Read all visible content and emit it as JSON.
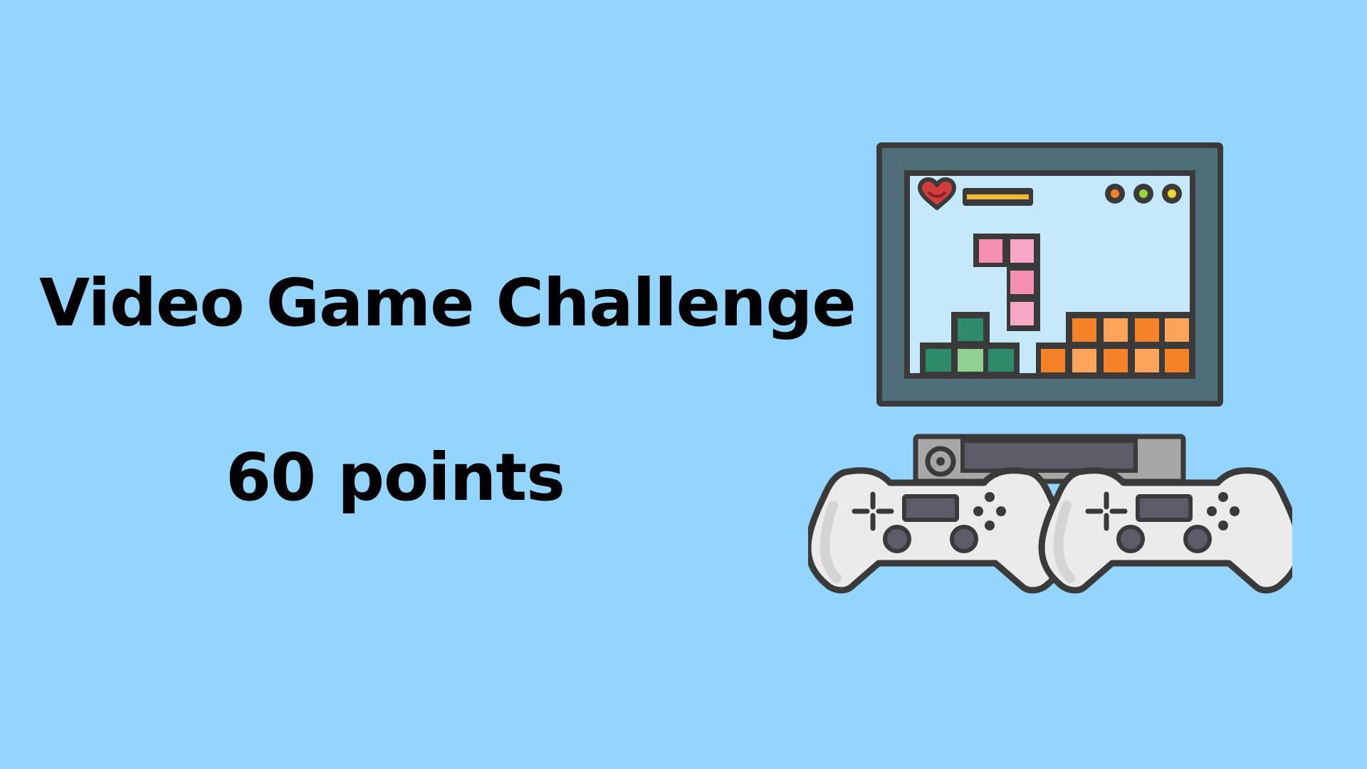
{
  "slide": {
    "title": "Video Game Challenge",
    "points": "60 points",
    "background_color": "#93d5fe",
    "text_color": "#000000"
  },
  "illustration": {
    "icons": [
      "tv-monitor-icon",
      "heart-icon",
      "game-console-icon",
      "gamepad-icon"
    ],
    "colors": {
      "outline": "#3a3a3a",
      "monitor_frame": "#4f6f78",
      "screen": "#c5e9fb",
      "heart": "#d13c3c",
      "pink_block": "#f48fb1",
      "green_block": "#2e8b68",
      "light_green_block": "#8fcf8f",
      "orange_block": "#f58226",
      "light_orange_block": "#fca55a",
      "console": "#a7a7a7",
      "controller": "#ebebeb"
    }
  }
}
